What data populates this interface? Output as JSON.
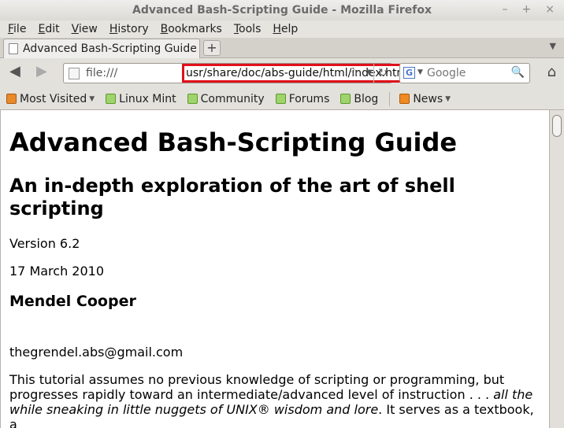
{
  "window": {
    "title": "Advanced Bash-Scripting Guide - Mozilla Firefox",
    "controls": [
      "–",
      "+",
      "×"
    ]
  },
  "menu": [
    "File",
    "Edit",
    "View",
    "History",
    "Bookmarks",
    "Tools",
    "Help"
  ],
  "tab": {
    "label": "Advanced Bash-Scripting Guide",
    "new_tab": "+"
  },
  "nav": {
    "back": "◀",
    "forward": "▶",
    "url_scheme": "file:///",
    "url_path": "usr/share/doc/abs-guide/html/index.html",
    "star": "☆",
    "dropdown": "▼",
    "reload": "↻",
    "search_engine": "G",
    "search_placeholder": "Google",
    "search_icon": "🔍",
    "home": "⌂"
  },
  "bookmarks": [
    {
      "label": "Most Visited",
      "icon": "most-visited-icon"
    },
    {
      "label": "Linux Mint",
      "icon": "mint-icon"
    },
    {
      "label": "Community",
      "icon": "mint-icon"
    },
    {
      "label": "Forums",
      "icon": "mint-icon"
    },
    {
      "label": "Blog",
      "icon": "mint-icon"
    },
    {
      "label": "News",
      "icon": "rss-icon"
    }
  ],
  "page": {
    "title": "Advanced Bash-Scripting Guide",
    "subtitle": "An in-depth exploration of the art of shell scripting",
    "version": "Version 6.2",
    "date": "17 March 2010",
    "author": "Mendel Cooper",
    "email": "thegrendel.abs@gmail.com",
    "intro_1": "This tutorial assumes no previous knowledge of scripting or programming, but progresses rapidly toward an intermediate/advanced level of instruction . . . ",
    "intro_em": "all the while sneaking in little nuggets of UNIX® wisdom and lore",
    "intro_2": ". It serves as a textbook, a"
  },
  "colors": {
    "highlight_box": "#e0101a"
  }
}
